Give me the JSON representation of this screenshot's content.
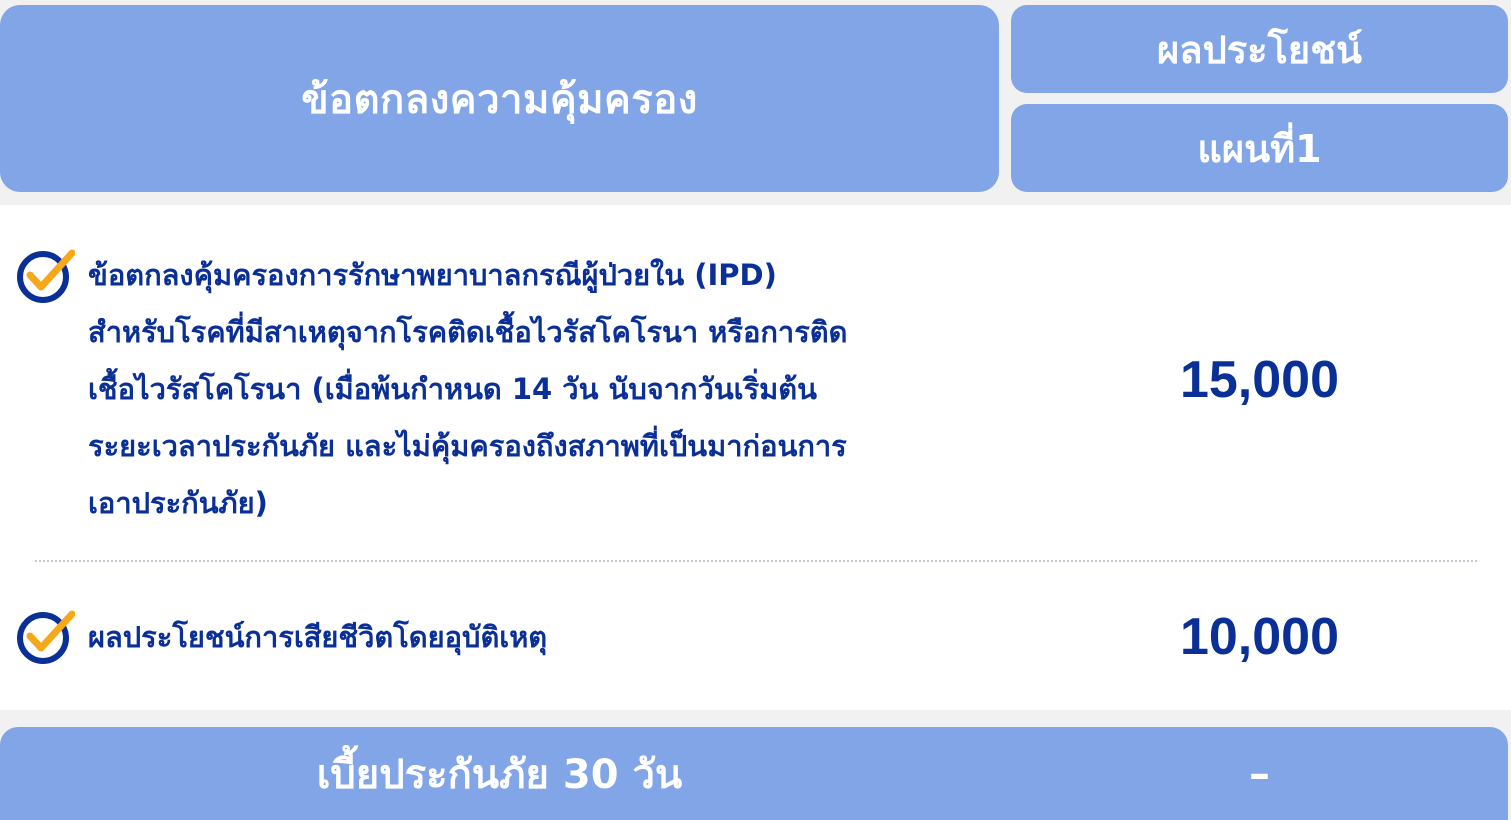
{
  "header": {
    "coverage_title": "ข้อตกลงความคุ้มครอง",
    "benefit_title": "ผลประโยชน์",
    "plan_title": "แผนที่1"
  },
  "rows": [
    {
      "icon": "check-circle-icon",
      "label": "ข้อตกลงคุ้มครองการรักษาพยาบาลกรณีผู้ป่วยใน (IPD) สำหรับโรคที่มีสาเหตุจากโรคติดเชื้อไวรัสโคโรนา หรือการติดเชื้อไวรัสโคโรนา (เมื่อพ้นกำหนด 14 วัน นับจากวันเริ่มต้นระยะเวลาประกันภัย และไม่คุ้มครองถึงสภาพที่เป็นมาก่อนการเอาประกันภัย)",
      "value": "15,000"
    },
    {
      "icon": "check-circle-icon",
      "label": "ผลประโยชน์การเสียชีวิตโดยอุบัติเหตุ",
      "value": "10,000"
    }
  ],
  "footer": {
    "premium_label": "เบี้ยประกันภัย 30 วัน",
    "premium_value": "–"
  },
  "colors": {
    "header_bg": "#81a5e7",
    "text_navy": "#0a2f97",
    "check_orange": "#f6a81b"
  }
}
